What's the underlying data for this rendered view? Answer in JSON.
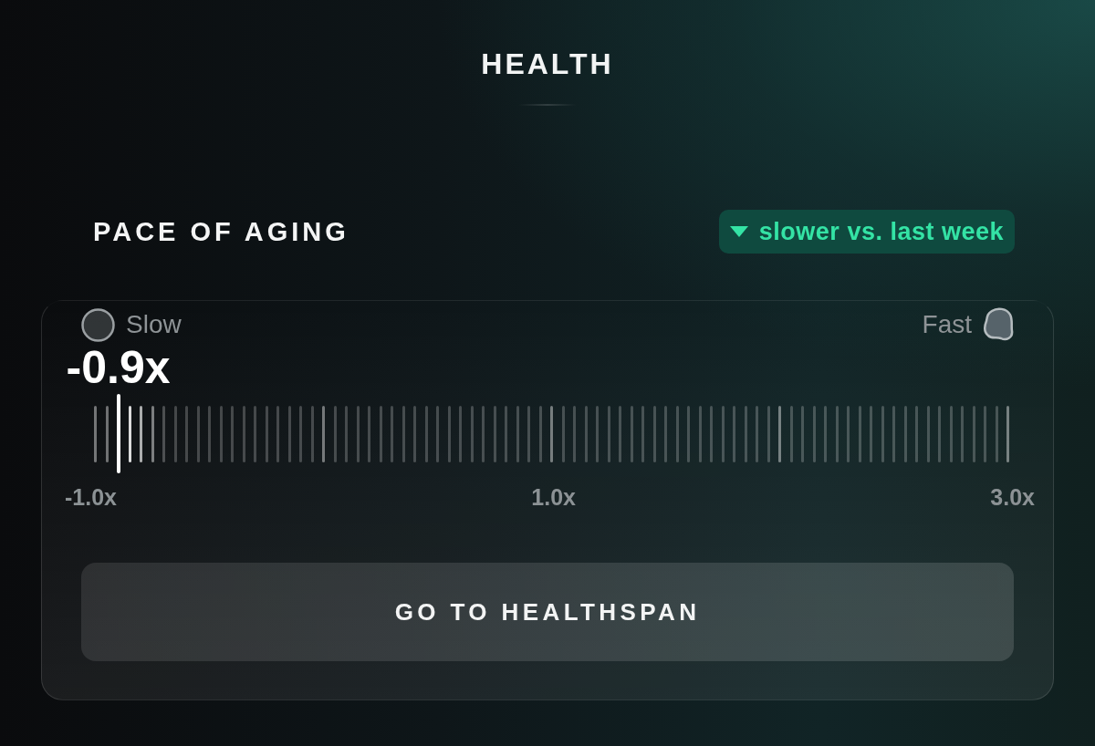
{
  "header": {
    "title": "HEALTH"
  },
  "pace_of_aging": {
    "title": "PACE OF AGING",
    "trend": {
      "decreasing": true,
      "label": "slower vs. last week"
    },
    "gauge": {
      "min_label": "Slow",
      "max_label": "Fast",
      "reading": "-0.9x",
      "level": 0.025,
      "scale_labels": [
        "-1.0x",
        "1.0x",
        "3.0x"
      ]
    },
    "button": "GO TO HEALTHSPAN"
  }
}
